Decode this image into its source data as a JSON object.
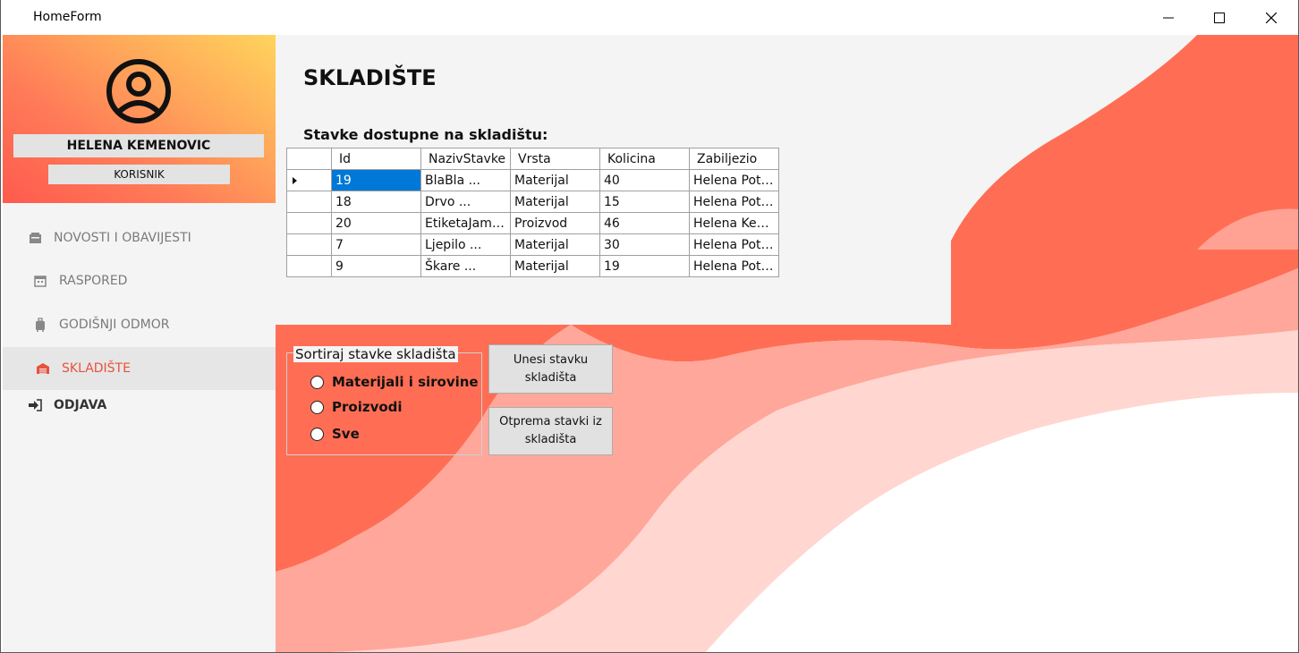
{
  "window": {
    "title": "HomeForm"
  },
  "user": {
    "name": "HELENA KEMENOVIC",
    "role": "KORISNIK"
  },
  "nav": {
    "novosti": "NOVOSTI I OBAVIJESTI",
    "raspored": "RASPORED",
    "godisnji": "GODIŠNJI ODMOR",
    "skladiste": "SKLADIŠTE",
    "odjava": "ODJAVA"
  },
  "page": {
    "title": "SKLADIŠTE",
    "table_title": "Stavke dostupne na skladištu:"
  },
  "table": {
    "columns": [
      "Id",
      "NazivStavke",
      "Vrsta",
      "Kolicina",
      "Zabiljezio"
    ],
    "rows": [
      [
        "19",
        "BlaBla        ...",
        "Materijal",
        "40",
        "Helena Poto..."
      ],
      [
        "18",
        "Drvo          ...",
        "Materijal",
        "15",
        "Helena Poto..."
      ],
      [
        "20",
        "EtiketaJamn...",
        "Proizvod",
        "46",
        "Helena Kem..."
      ],
      [
        "7",
        "Ljepilo       ...",
        "Materijal",
        "30",
        "Helena Poto..."
      ],
      [
        "9",
        "Škare         ...",
        "Materijal",
        "19",
        "Helena Poto..."
      ]
    ]
  },
  "sort": {
    "legend": "Sortiraj stavke skladišta",
    "options": [
      "Materijali i sirovine",
      "Proizvodi",
      "Sve"
    ]
  },
  "buttons": {
    "unesi": "Unesi stavku skladišta",
    "otprema": "Otprema stavki iz skladišta"
  },
  "colors": {
    "accent": "#e8523a",
    "selection": "#0078d7"
  }
}
